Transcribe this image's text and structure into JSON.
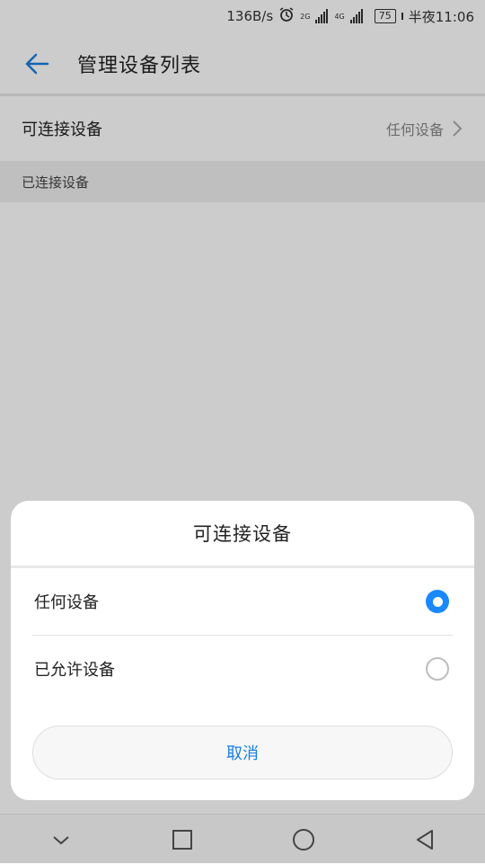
{
  "status_bar": {
    "net_speed": "136B/s",
    "net1": "2G",
    "net2": "4G",
    "battery": "75",
    "time": "半夜11:06"
  },
  "app_bar": {
    "title": "管理设备列表"
  },
  "settings": {
    "connectable_label": "可连接设备",
    "connectable_value": "任何设备",
    "connected_section": "已连接设备"
  },
  "dialog": {
    "title": "可连接设备",
    "options": [
      {
        "label": "任何设备",
        "selected": true
      },
      {
        "label": "已允许设备",
        "selected": false
      }
    ],
    "cancel_label": "取消"
  },
  "colors": {
    "accent": "#1a88ff",
    "scrim": "rgba(0,0,0,0.2)"
  }
}
